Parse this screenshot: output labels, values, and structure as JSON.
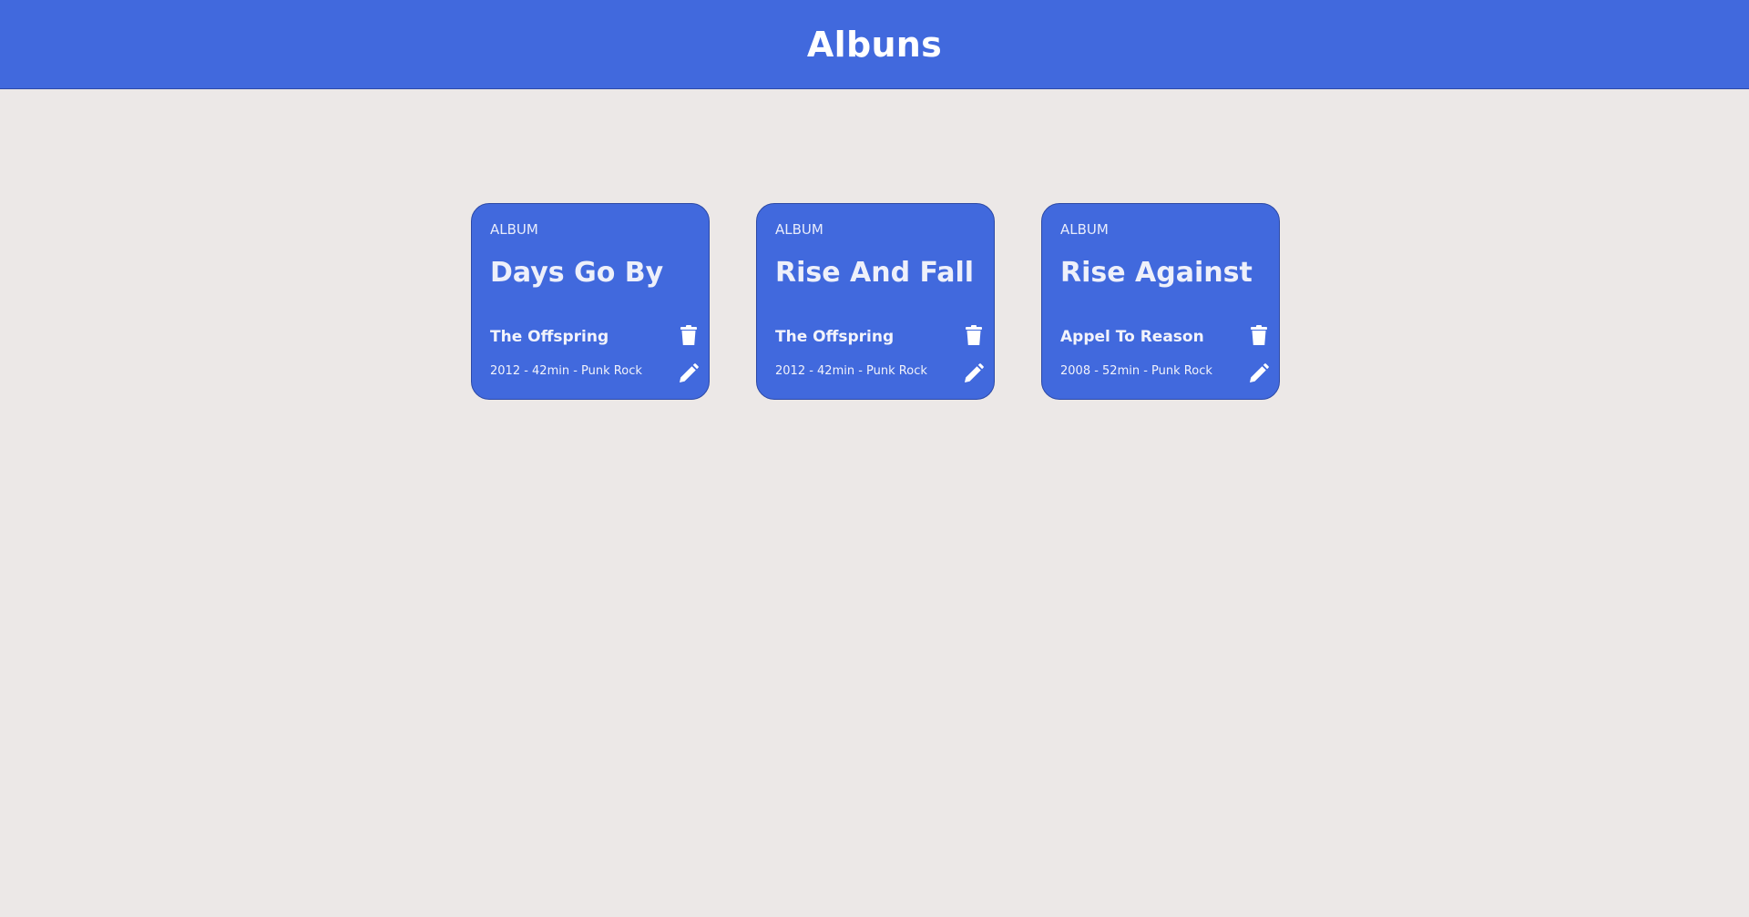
{
  "header": {
    "title": "Albuns"
  },
  "albums": [
    {
      "label": "ALBUM",
      "title": "Days Go By",
      "artist": "The Offspring",
      "meta": "2012 - 42min - Punk Rock"
    },
    {
      "label": "ALBUM",
      "title": "Rise And Fall",
      "artist": "The Offspring",
      "meta": "2012 - 42min - Punk Rock"
    },
    {
      "label": "ALBUM",
      "title": "Rise Against",
      "artist": "Appel To Reason",
      "meta": "2008 - 52min - Punk Rock"
    }
  ],
  "icons": {
    "delete": "trash-icon",
    "edit": "pencil-icon"
  },
  "colors": {
    "accent": "#4169dd",
    "background": "#ece8e7",
    "text": "#ffffff"
  }
}
